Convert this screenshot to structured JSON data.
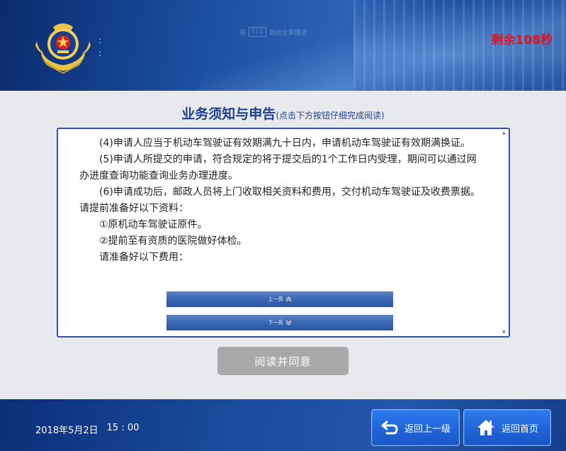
{
  "header": {
    "hint_prefix": "按",
    "hint_key": "F11",
    "hint_text": "退出全屏模式",
    "countdown": "剩余108秒",
    "side_marks": [
      ":",
      ":"
    ]
  },
  "notice": {
    "title": "业务须知与申告",
    "subtitle": "(点击下方按钮仔细完成阅读)",
    "paragraphs": [
      "(4)申请人应当于机动车驾驶证有效期满九十日内，申请机动车驾驶证有效期满换证。",
      "(5)申请人所提交的申请，符合规定的将于提交后的1个工作日内受理，期间可以通过网办进度查询功能查询业务办理进度。",
      "(6)申请成功后，邮政人员将上门收取相关资料和费用，交付机动车驾驶证及收费票据。请提前准备好以下资料：",
      "①原机动车驾驶证原件。",
      "②提前至有资质的医院做好体检。",
      "请准备好以下费用："
    ],
    "prev_label": "上一页",
    "next_label": "下一页",
    "prev_icon": "double-chevron-up-icon",
    "next_icon": "double-chevron-down-icon"
  },
  "agree_label": "阅读并同意",
  "footer": {
    "date": "2018年5月2日",
    "time": "15 : 00",
    "back_label": "返回上一级",
    "home_label": "返回首页",
    "back_icon": "return-arrow-icon",
    "home_icon": "home-icon"
  },
  "colors": {
    "countdown": "#e8101a",
    "title": "#1f3f8f",
    "panel_border": "#3652a8",
    "nav_button": "#1f63d6",
    "agree_disabled": "#a9a9a9"
  }
}
